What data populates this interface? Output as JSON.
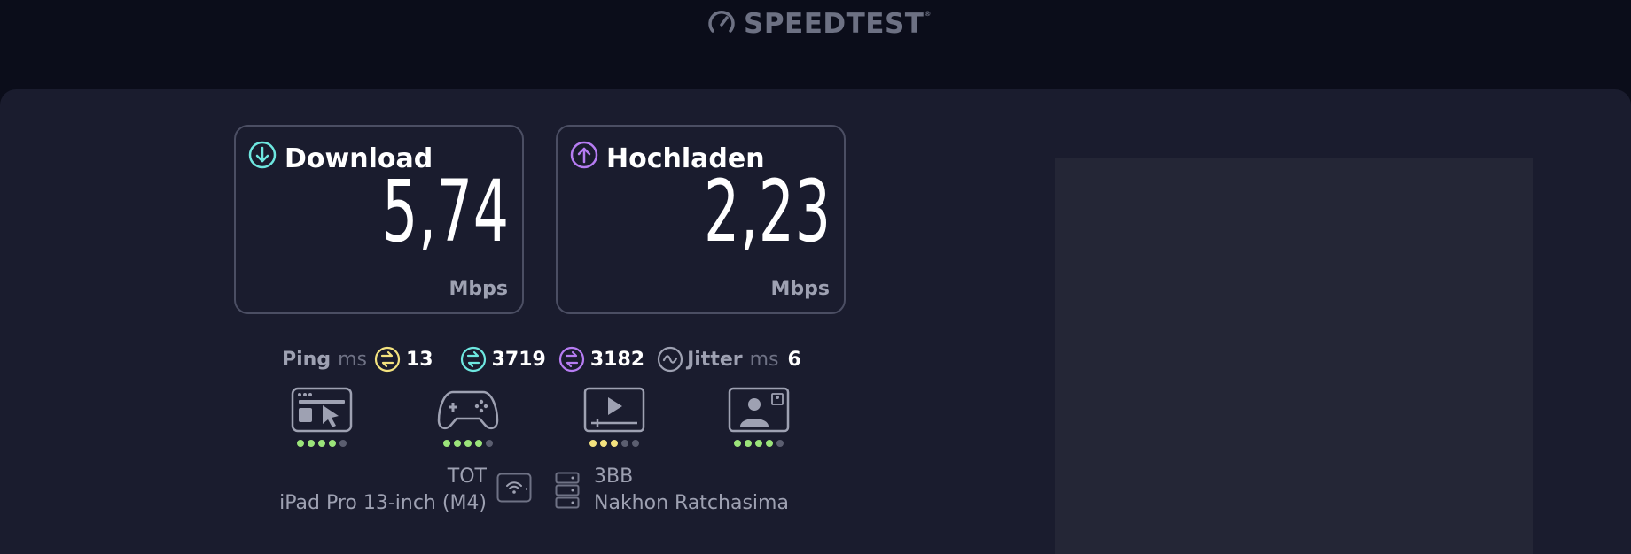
{
  "brand": {
    "name": "SPEEDTEST",
    "mark": "®"
  },
  "download": {
    "label": "Download",
    "value": "5,74",
    "unit": "Mbps",
    "icon": "arrow-down-circle-icon",
    "color": "#6ee7e0"
  },
  "upload": {
    "label": "Hochladen",
    "value": "2,23",
    "unit": "Mbps",
    "icon": "arrow-up-circle-icon",
    "color": "#b67cf2"
  },
  "metrics": {
    "ping_label": "Ping",
    "ping_unit": "ms",
    "idle_ping": "13",
    "download_ping": "3719",
    "upload_ping": "3182",
    "jitter_label": "Jitter",
    "jitter_unit": "ms",
    "jitter_value": "6"
  },
  "use_cases": [
    {
      "icon": "browsing-icon",
      "rating": 4,
      "max": 5,
      "color": "#9be47a"
    },
    {
      "icon": "gaming-icon",
      "rating": 4,
      "max": 5,
      "color": "#9be47a"
    },
    {
      "icon": "streaming-icon",
      "rating": 3,
      "max": 5,
      "color": "#f3e27f"
    },
    {
      "icon": "video-call-icon",
      "rating": 4,
      "max": 5,
      "color": "#9be47a"
    }
  ],
  "connection": {
    "provider": "TOT",
    "device": "iPad Pro 13-inch (M4)",
    "server_name": "3BB",
    "server_location": "Nakhon Ratchasima"
  }
}
